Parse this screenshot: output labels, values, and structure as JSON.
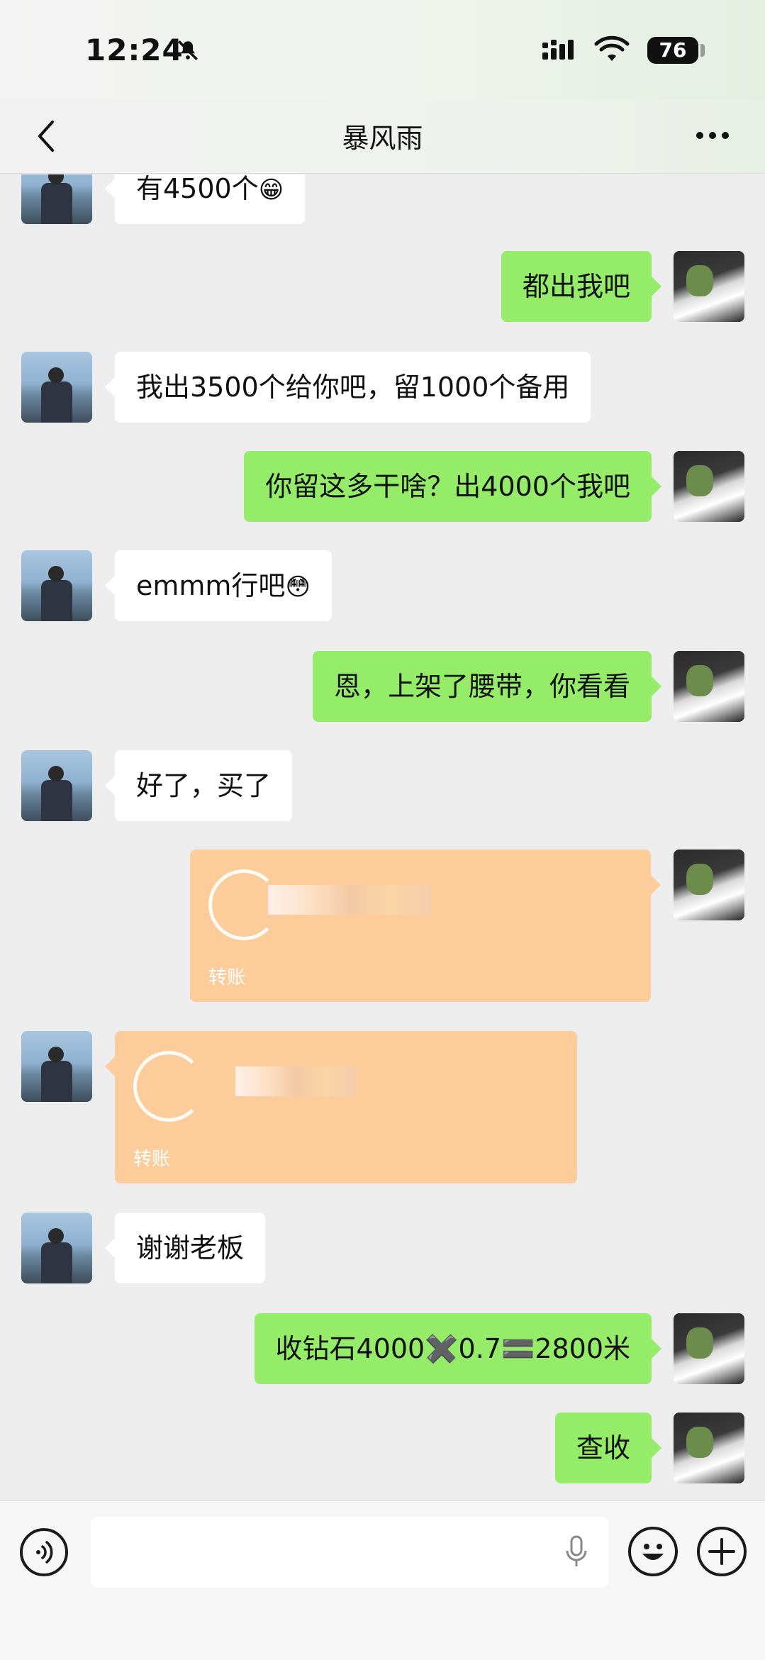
{
  "status": {
    "time": "12:24",
    "battery": "76",
    "icons": [
      "bell-slash-icon",
      "signal-icon",
      "wifi-icon",
      "battery-icon"
    ]
  },
  "nav": {
    "title": "暴风雨",
    "back_icon": "chevron-left-icon",
    "more_icon": "more-horizontal-icon"
  },
  "messages": [
    {
      "from": "them",
      "text": "有4500个",
      "emoji": "😁"
    },
    {
      "from": "me",
      "text": "都出我吧"
    },
    {
      "from": "them",
      "text": "我出3500个给你吧，留1000个备用"
    },
    {
      "from": "me",
      "text": "你留这多干啥？出4000个我吧"
    },
    {
      "from": "them",
      "text": "emmm行吧",
      "emoji": "😳"
    },
    {
      "from": "me",
      "text": "恩，上架了腰带，你看看"
    },
    {
      "from": "them",
      "text": "好了，买了"
    },
    {
      "from": "me",
      "type": "transfer",
      "label": "转账"
    },
    {
      "from": "them",
      "type": "transfer",
      "label": "转账"
    },
    {
      "from": "them",
      "text": "谢谢老板"
    },
    {
      "from": "me",
      "text": "收钻石4000✖️0.7🟰2800米"
    },
    {
      "from": "me",
      "text": "查收"
    }
  ],
  "input": {
    "voice_icon": "voice-icon",
    "mic_icon": "microphone-icon",
    "emoji_icon": "smiley-icon",
    "plus_icon": "plus-circle-icon",
    "value": ""
  },
  "colors": {
    "background": "#ededed",
    "bubble_me": "#95ec69",
    "bubble_them": "#ffffff",
    "transfer": "#fdcc9b"
  }
}
